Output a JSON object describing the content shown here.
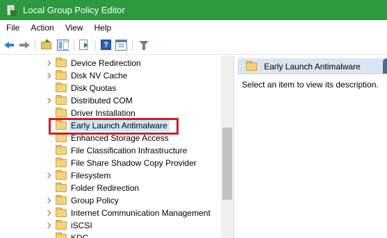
{
  "window": {
    "title": "Local Group Policy Editor",
    "icon": "gpedit-icon"
  },
  "menubar": {
    "items": [
      "File",
      "Action",
      "View",
      "Help"
    ]
  },
  "toolbar": {
    "buttons": [
      "back-icon",
      "forward-icon",
      "up-folder-icon",
      "show-hide-tree-icon",
      "export-list-icon",
      "help-icon",
      "properties-icon",
      "filter-icon"
    ],
    "help_glyph": "?"
  },
  "tree": {
    "items": [
      {
        "label": "Device Redirection",
        "expandable": true,
        "selected": false
      },
      {
        "label": "Disk NV Cache",
        "expandable": true,
        "selected": false
      },
      {
        "label": "Disk Quotas",
        "expandable": false,
        "selected": false
      },
      {
        "label": "Distributed COM",
        "expandable": true,
        "selected": false
      },
      {
        "label": "Driver Installation",
        "expandable": false,
        "selected": false
      },
      {
        "label": "Early Launch Antimalware",
        "expandable": false,
        "selected": true
      },
      {
        "label": "Enhanced Storage Access",
        "expandable": false,
        "selected": false
      },
      {
        "label": "File Classification Infrastructure",
        "expandable": false,
        "selected": false
      },
      {
        "label": "File Share Shadow Copy Provider",
        "expandable": false,
        "selected": false
      },
      {
        "label": "Filesystem",
        "expandable": true,
        "selected": false
      },
      {
        "label": "Folder Redirection",
        "expandable": false,
        "selected": false
      },
      {
        "label": "Group Policy",
        "expandable": true,
        "selected": false
      },
      {
        "label": "Internet Communication Management",
        "expandable": true,
        "selected": false
      },
      {
        "label": "iSCSI",
        "expandable": true,
        "selected": false
      },
      {
        "label": "KDC",
        "expandable": false,
        "selected": false
      }
    ]
  },
  "right_pane": {
    "header_title": "Early Launch Antimalware",
    "description": "Select an item to view its description."
  },
  "colors": {
    "titlebar": "#2d9a3f",
    "selection": "#cce8ff",
    "highlight_box": "#d11c24",
    "header_bg": "#dbe5f2"
  }
}
